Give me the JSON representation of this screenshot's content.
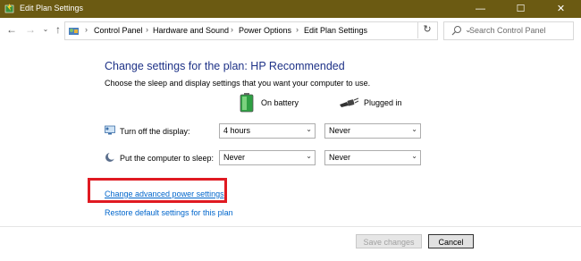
{
  "window": {
    "title": "Edit Plan Settings",
    "title_bar_color": "#6b5a12",
    "controls": {
      "minimize": "—",
      "maximize": "☐",
      "close": "✕"
    }
  },
  "address_bar": {
    "back_icon": "back-arrow-icon",
    "forward_icon": "forward-arrow-icon",
    "recent_icon": "chevron-down-icon",
    "up_icon": "up-arrow-icon",
    "breadcrumbs": [
      "Control Panel",
      "Hardware and Sound",
      "Power Options",
      "Edit Plan Settings"
    ],
    "refresh_icon": "refresh-icon",
    "search_placeholder": "Search Control Panel"
  },
  "main": {
    "heading": "Change settings for the plan: HP Recommended",
    "subtext": "Choose the sleep and display settings that you want your computer to use.",
    "columns": {
      "on_battery": "On battery",
      "plugged_in": "Plugged in"
    },
    "rows": [
      {
        "label": "Turn off the display:",
        "icon": "monitor-icon",
        "on_battery": "4 hours",
        "plugged_in": "Never"
      },
      {
        "label": "Put the computer to sleep:",
        "icon": "moon-icon",
        "on_battery": "Never",
        "plugged_in": "Never"
      }
    ],
    "links": {
      "advanced": "Change advanced power settings",
      "restore": "Restore default settings for this plan"
    },
    "highlight_color": "#e01a22"
  },
  "footer": {
    "save_label": "Save changes",
    "cancel_label": "Cancel"
  }
}
